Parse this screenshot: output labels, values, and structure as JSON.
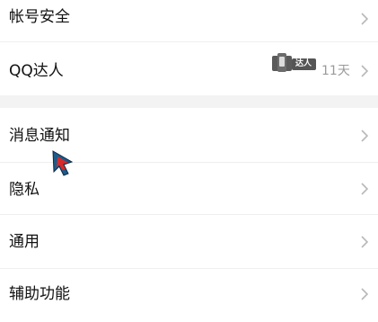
{
  "settings": {
    "account_security": "帐号安全",
    "qq_master": "QQ达人",
    "qq_master_badge": "达人",
    "qq_master_days": "11天",
    "notifications": "消息通知",
    "privacy": "隐私",
    "general": "通用",
    "accessibility": "辅助功能"
  },
  "colors": {
    "text": "#111111",
    "secondary_text": "#9a9a9a",
    "chevron": "#b8b8b8",
    "section_gap": "#f3f3f3",
    "divider": "#efefef"
  },
  "icons": {
    "chevron": "chevron-right-icon",
    "badge": "qq-master-badge-icon",
    "cursor": "mouse-pointer-icon"
  }
}
